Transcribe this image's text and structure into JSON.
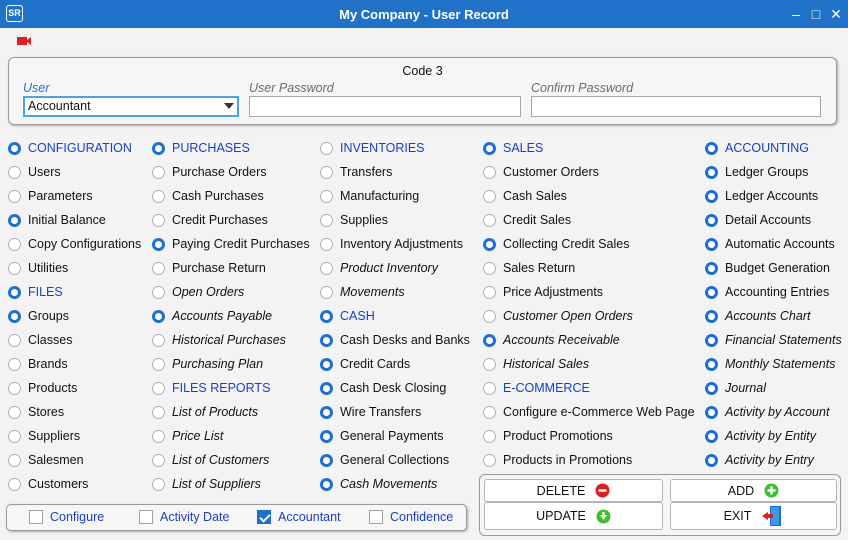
{
  "window": {
    "title": "My Company - User Record",
    "logo": "SR"
  },
  "form": {
    "code": "Code 3",
    "user_label": "User",
    "user_value": "Accountant",
    "password_label": "User Password",
    "password_value": "",
    "confirm_label": "Confirm Password",
    "confirm_value": ""
  },
  "columns": [
    {
      "items": [
        {
          "label": "CONFIGURATION",
          "on": true,
          "hdr": true
        },
        {
          "label": "Users",
          "on": false
        },
        {
          "label": "Parameters",
          "on": false
        },
        {
          "label": "Initial Balance",
          "on": true
        },
        {
          "label": "Copy Configurations",
          "on": false
        },
        {
          "label": "Utilities",
          "on": false
        },
        {
          "label": "FILES",
          "on": true,
          "hdr": true
        },
        {
          "label": "Groups",
          "on": true
        },
        {
          "label": "Classes",
          "on": false
        },
        {
          "label": "Brands",
          "on": false
        },
        {
          "label": "Products",
          "on": false
        },
        {
          "label": "Stores",
          "on": false
        },
        {
          "label": "Suppliers",
          "on": false
        },
        {
          "label": "Salesmen",
          "on": false
        },
        {
          "label": "Customers",
          "on": false
        }
      ]
    },
    {
      "items": [
        {
          "label": "PURCHASES",
          "on": true,
          "hdr": true
        },
        {
          "label": "Purchase Orders",
          "on": false
        },
        {
          "label": "Cash Purchases",
          "on": false
        },
        {
          "label": "Credit Purchases",
          "on": false
        },
        {
          "label": "Paying Credit Purchases",
          "on": true
        },
        {
          "label": "Purchase Return",
          "on": false
        },
        {
          "label": "Open Orders",
          "on": false,
          "it": true
        },
        {
          "label": "Accounts Payable",
          "on": true,
          "it": true
        },
        {
          "label": "Historical Purchases",
          "on": false,
          "it": true
        },
        {
          "label": "Purchasing Plan",
          "on": false,
          "it": true
        },
        {
          "label": "FILES REPORTS",
          "on": false,
          "hdr": true
        },
        {
          "label": "List of Products",
          "on": false,
          "it": true
        },
        {
          "label": "Price List",
          "on": false,
          "it": true
        },
        {
          "label": "List of Customers",
          "on": false,
          "it": true
        },
        {
          "label": "List of Suppliers",
          "on": false,
          "it": true
        }
      ]
    },
    {
      "items": [
        {
          "label": "INVENTORIES",
          "on": false,
          "hdr": true
        },
        {
          "label": "Transfers",
          "on": false
        },
        {
          "label": "Manufacturing",
          "on": false
        },
        {
          "label": "Supplies",
          "on": false
        },
        {
          "label": "Inventory Adjustments",
          "on": false
        },
        {
          "label": "Product Inventory",
          "on": false,
          "it": true
        },
        {
          "label": "Movements",
          "on": false,
          "it": true
        },
        {
          "label": "CASH",
          "on": true,
          "hdr": true
        },
        {
          "label": "Cash Desks and Banks",
          "on": true
        },
        {
          "label": "Credit Cards",
          "on": true
        },
        {
          "label": "Cash Desk Closing",
          "on": true
        },
        {
          "label": "Wire Transfers",
          "on": true
        },
        {
          "label": "General Payments",
          "on": true
        },
        {
          "label": "General Collections",
          "on": true
        },
        {
          "label": "Cash Movements",
          "on": true,
          "it": true
        }
      ]
    },
    {
      "items": [
        {
          "label": "SALES",
          "on": true,
          "hdr": true
        },
        {
          "label": "Customer Orders",
          "on": false
        },
        {
          "label": "Cash Sales",
          "on": false
        },
        {
          "label": "Credit Sales",
          "on": false
        },
        {
          "label": "Collecting Credit Sales",
          "on": true
        },
        {
          "label": "Sales Return",
          "on": false
        },
        {
          "label": "Price Adjustments",
          "on": false
        },
        {
          "label": "Customer Open Orders",
          "on": false,
          "it": true
        },
        {
          "label": "Accounts Receivable",
          "on": true,
          "it": true
        },
        {
          "label": "Historical Sales",
          "on": false,
          "it": true
        },
        {
          "label": "E-COMMERCE",
          "on": false,
          "hdr": true
        },
        {
          "label": "Configure e-Commerce Web Page",
          "on": false
        },
        {
          "label": "Product Promotions",
          "on": false
        },
        {
          "label": "Products in Promotions",
          "on": false
        }
      ]
    },
    {
      "items": [
        {
          "label": "ACCOUNTING",
          "on": true,
          "hdr": true
        },
        {
          "label": "Ledger Groups",
          "on": true
        },
        {
          "label": "Ledger Accounts",
          "on": true
        },
        {
          "label": "Detail Accounts",
          "on": true
        },
        {
          "label": "Automatic Accounts",
          "on": true
        },
        {
          "label": "Budget Generation",
          "on": true
        },
        {
          "label": "Accounting Entries",
          "on": true
        },
        {
          "label": "Accounts Chart",
          "on": true,
          "it": true
        },
        {
          "label": "Financial Statements",
          "on": true,
          "it": true
        },
        {
          "label": "Monthly Statements",
          "on": true,
          "it": true
        },
        {
          "label": "Journal",
          "on": true,
          "it": true
        },
        {
          "label": "Activity by Account",
          "on": true,
          "it": true
        },
        {
          "label": "Activity by Entity",
          "on": true,
          "it": true
        },
        {
          "label": "Activity by Entry",
          "on": true,
          "it": true
        }
      ]
    }
  ],
  "checkboxes": [
    {
      "label": "Configure",
      "checked": false
    },
    {
      "label": "Activity Date",
      "checked": false
    },
    {
      "label": "Accountant",
      "checked": true
    },
    {
      "label": "Confidence",
      "checked": false
    }
  ],
  "buttons": {
    "delete": "DELETE",
    "add": "ADD",
    "update": "UPDATE",
    "exit": "EXIT"
  },
  "colors": {
    "accent": "#1f6fd0",
    "titlebar": "#1f72c8",
    "header_text": "#1a3fc4",
    "delete_icon": "#e02020",
    "add_icon": "#3fbf2f"
  }
}
